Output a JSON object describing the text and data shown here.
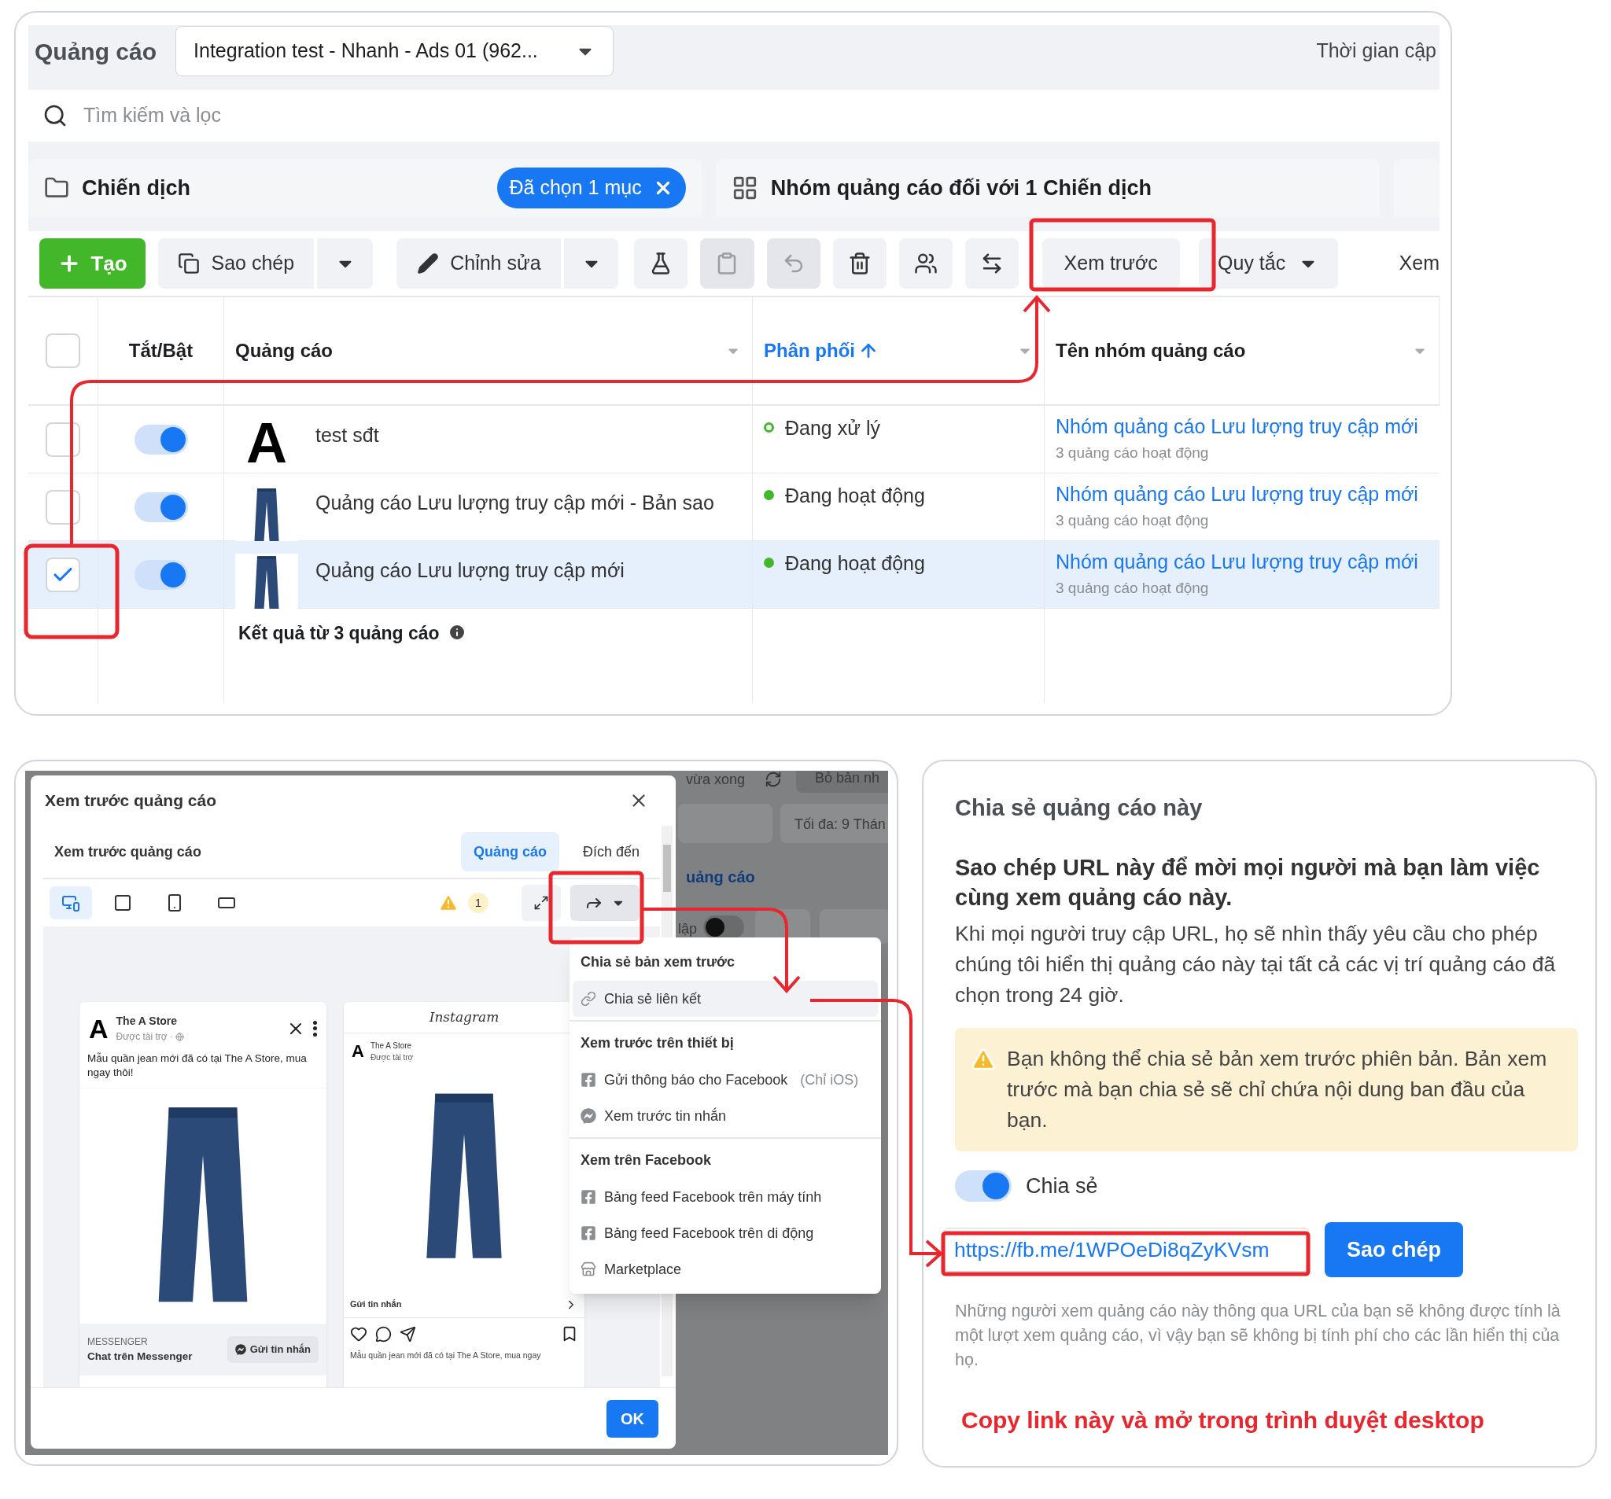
{
  "ads_manager": {
    "title": "Quảng cáo",
    "account_dropdown": "Integration test - Nhanh - Ads 01 (962...",
    "last_updated": "Thời gian cập",
    "search": {
      "placeholder": "Tìm kiếm và lọc"
    },
    "campaign_tab": {
      "label": "Chiến dịch",
      "selection_chip": "Đã chọn 1 mục"
    },
    "adset_tab": {
      "label": "Nhóm quảng cáo đối với 1 Chiến dịch"
    },
    "toolbar": {
      "create": "Tạo",
      "copy": "Sao chép",
      "edit": "Chỉnh sửa",
      "preview": "Xem trước",
      "rules": "Quy tắc",
      "more": "Xem"
    },
    "icon_buttons": [
      {
        "disabled": false
      },
      {
        "disabled": true
      },
      {
        "disabled": true
      },
      {
        "disabled": false
      },
      {
        "disabled": false
      },
      {
        "disabled": false
      }
    ],
    "table": {
      "select_all": {
        "checked": false
      },
      "columns": [
        {
          "label": "Tắt/Bật",
          "sorted": false
        },
        {
          "label": "Quảng cáo",
          "sorted": false
        },
        {
          "label": "Phân phối",
          "sorted": true
        },
        {
          "label": "Tên nhóm quảng cáo",
          "sorted": false
        }
      ],
      "rows": [
        {
          "checked": false,
          "selected": false,
          "on": true,
          "thumbnail": {
            "kind": "logo",
            "text": "A"
          },
          "name": "test sđt",
          "status": {
            "kind": "pending",
            "label": "Đang xử lý"
          },
          "ad_set": "Nhóm quảng cáo Lưu lượng truy cập mới",
          "ad_set_info": "3 quảng cáo hoạt động"
        },
        {
          "checked": false,
          "selected": false,
          "on": true,
          "thumbnail": {
            "kind": "photo"
          },
          "name": "Quảng cáo Lưu lượng truy cập mới - Bản sao",
          "status": {
            "kind": "active",
            "label": "Đang hoạt động"
          },
          "ad_set": "Nhóm quảng cáo Lưu lượng truy cập mới",
          "ad_set_info": "3 quảng cáo hoạt động"
        },
        {
          "checked": true,
          "selected": true,
          "on": true,
          "thumbnail": {
            "kind": "photo"
          },
          "name": "Quảng cáo Lưu lượng truy cập mới",
          "status": {
            "kind": "active",
            "label": "Đang hoạt động"
          },
          "ad_set": "Nhóm quảng cáo Lưu lượng truy cập mới",
          "ad_set_info": "3 quảng cáo hoạt động"
        }
      ],
      "footer": "Kết quả từ 3 quảng cáo"
    }
  },
  "backdrop": {
    "last_updated": "vừa xong",
    "toggle": {
      "on": false
    },
    "discard": "Bỏ bản nh",
    "max": "Tối đa: 9 Thán",
    "section": "uảng cáo",
    "toggle_label": "lập"
  },
  "preview_modal": {
    "title": "Xem trước quảng cáo",
    "subtitle": "Xem trước quảng cáo",
    "tabs": [
      {
        "label": "Quảng cáo",
        "selected": true
      },
      {
        "label": "Đích đến",
        "selected": false
      }
    ],
    "device_buttons": [
      {
        "selected": true
      },
      {
        "selected": false
      },
      {
        "selected": false
      },
      {
        "selected": false
      }
    ],
    "warning_count": "1",
    "facebook_preview": {
      "logo": "A",
      "page": "The A Store",
      "sponsored": "Được tài trợ ·",
      "text": "Mẫu quần jean mới đã có tại The A Store, mua ngay thôi!",
      "cta_label": "MESSENGER",
      "cta_title": "Chat trên Messenger",
      "cta_button": "Gửi tin nhắn"
    },
    "instagram_preview": {
      "brand": "Instagram",
      "logo": "A",
      "page": "The A Store",
      "sponsored": "Được tài trợ",
      "cta": "Gửi tin nhắn",
      "caption": "Mẫu quần jean mới đã có tại The A Store, mua ngay"
    },
    "ok": "OK"
  },
  "share_menu": {
    "sections": [
      {
        "title": "Chia sẻ bản xem trước",
        "items": [
          {
            "kind": "link",
            "label": "Chia sẻ liên kết",
            "selected": true
          }
        ]
      },
      {
        "title": "Xem trước trên thiết bị",
        "items": [
          {
            "kind": "facebook",
            "label": "Gửi thông báo cho Facebook",
            "note": "(Chỉ iOS)",
            "selected": false
          },
          {
            "kind": "messenger",
            "label": "Xem trước tin nhắn",
            "selected": false
          }
        ]
      },
      {
        "title": "Xem trên Facebook",
        "items": [
          {
            "kind": "facebook",
            "label": "Bảng feed Facebook trên máy tính",
            "selected": false
          },
          {
            "kind": "facebook",
            "label": "Bảng feed Facebook trên di động",
            "selected": false
          },
          {
            "kind": "store",
            "label": "Marketplace",
            "selected": false
          }
        ]
      }
    ]
  },
  "share_panel": {
    "title": "Chia sẻ quảng cáo này",
    "heading": "Sao chép URL này để mời mọi người mà bạn làm việc cùng xem quảng cáo này.",
    "body": "Khi mọi người truy cập URL, họ sẽ nhìn thấy yêu cầu cho phép chúng tôi hiển thị quảng cáo này tại tất cả các vị trí quảng cáo đã chọn trong 24 giờ.",
    "warning": "Bạn không thể chia sẻ bản xem trước phiên bản. Bản xem trước mà bạn chia sẻ sẽ chỉ chứa nội dung ban đầu của bạn.",
    "share_toggle": {
      "label": "Chia sẻ",
      "on": true
    },
    "url": "https://fb.me/1WPOeDi8qZyKVsm",
    "copy_button": "Sao chép",
    "note": "Những người xem quảng cáo này thông qua URL của bạn sẽ không được tính là một lượt xem quảng cáo, vì vậy bạn sẽ không bị tính phí cho các lần hiển thị của họ.",
    "caption": "Copy link này và mở trong trình duyệt desktop"
  }
}
